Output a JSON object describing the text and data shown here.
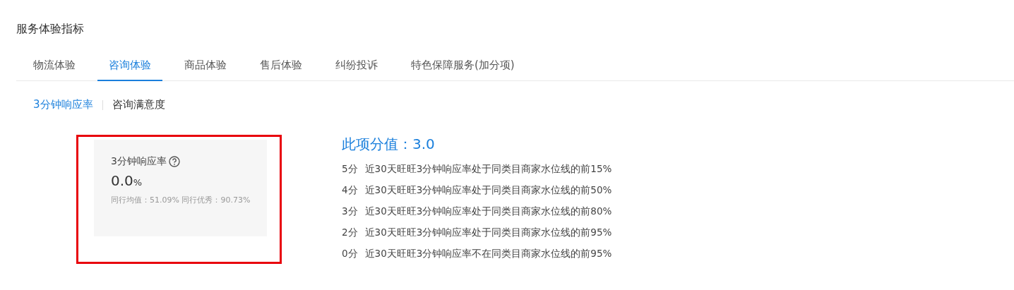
{
  "page_title": "服务体验指标",
  "tabs": [
    {
      "label": "物流体验",
      "selected": false
    },
    {
      "label": "咨询体验",
      "selected": true
    },
    {
      "label": "商品体验",
      "selected": false
    },
    {
      "label": "售后体验",
      "selected": false
    },
    {
      "label": "纠纷投诉",
      "selected": false
    },
    {
      "label": "特色保障服务(加分项)",
      "selected": false
    }
  ],
  "sub_tabs": [
    {
      "label": "3分钟响应率",
      "selected": true
    },
    {
      "label": "咨询满意度",
      "selected": false
    }
  ],
  "metric_card": {
    "title": "3分钟响应率",
    "value": "0.0",
    "unit": "%",
    "peer_average": "同行均值：51.09%",
    "peer_excellent": "同行优秀：90.73%",
    "highlighted": true
  },
  "score": {
    "label": "此项分值：3.0"
  },
  "score_rules": [
    {
      "points": "5分",
      "rule": "近30天旺旺3分钟响应率处于同类目商家水位线的前15%"
    },
    {
      "points": "4分",
      "rule": "近30天旺旺3分钟响应率处于同类目商家水位线的前50%"
    },
    {
      "points": "3分",
      "rule": "近30天旺旺3分钟响应率处于同类目商家水位线的前80%"
    },
    {
      "points": "2分",
      "rule": "近30天旺旺3分钟响应率处于同类目商家水位线的前95%"
    },
    {
      "points": "0分",
      "rule": "近30天旺旺3分钟响应率不在同类目商家水位线的前95%"
    }
  ]
}
